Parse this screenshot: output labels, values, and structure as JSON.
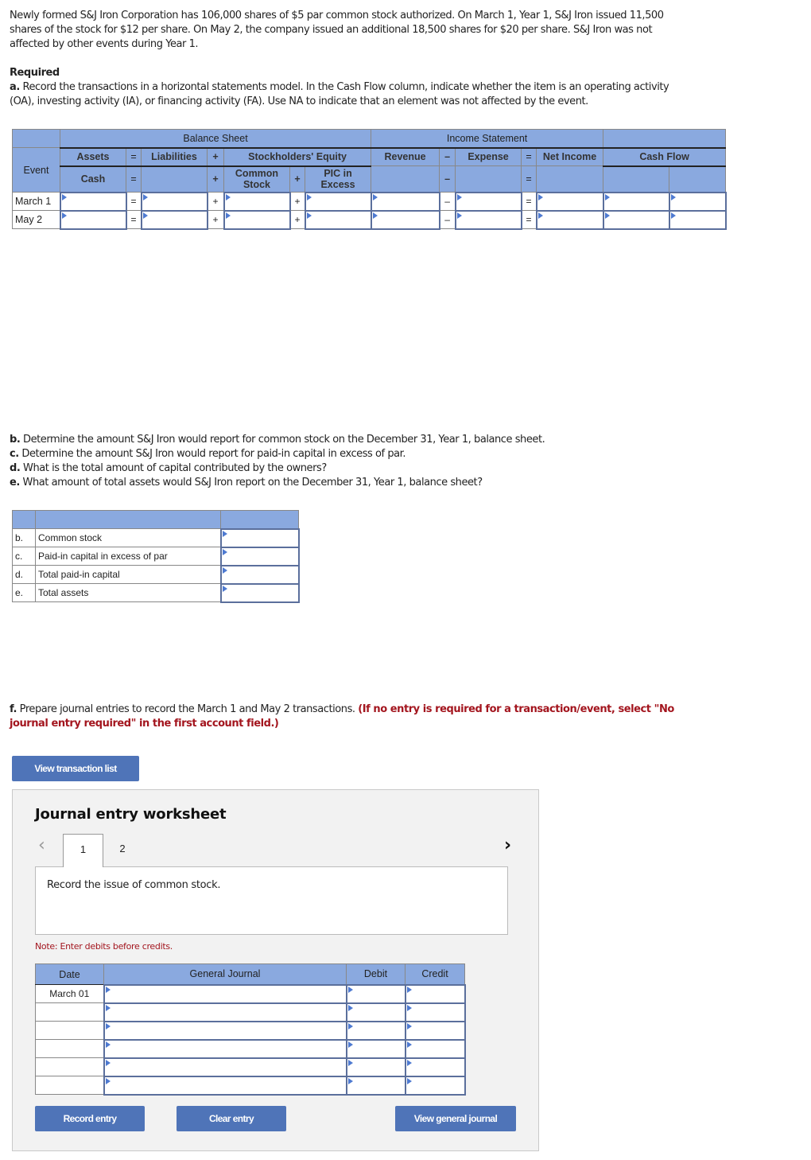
{
  "problem": {
    "intro": "Newly formed S&J Iron Corporation has 106,000 shares of $5 par common stock authorized. On March 1, Year 1, S&J Iron issued 11,500 shares of the stock for $12 per share. On May 2, the company issued an additional 18,500 shares for $20 per share. S&J Iron was not affected by other events during Year 1.",
    "intro_lines": [
      "Newly formed S&J Iron Corporation has 106,000 shares of $5 par common stock authorized. On March 1, Year 1, S&J Iron issued 11,500",
      "shares of the stock for $12 per share. On May 2, the company issued an additional 18,500 shares for $20 per share. S&J Iron was not",
      "affected by other events during Year 1."
    ],
    "required_label": "Required",
    "part_a_letter": "a.",
    "part_a_lines": [
      " Record the transactions in a horizontal statements model. In the Cash Flow column, indicate whether the item is an operating activity",
      "(OA), investing activity (IA), or financing activity (FA). Use NA to indicate that an element was not affected by the event."
    ]
  },
  "statements_model": {
    "group_headers": {
      "balance_sheet": "Balance Sheet",
      "income_statement": "Income Statement"
    },
    "row2": {
      "assets": "Assets",
      "eq": "=",
      "liabilities": "Liabilities",
      "plus": "+",
      "stockholders_equity": "Stockholders' Equity",
      "revenue": "Revenue",
      "minus": "–",
      "expense": "Expense",
      "eq2": "=",
      "net_income": "Net Income",
      "cash_flow": "Cash Flow"
    },
    "row3": {
      "event": "Event",
      "cash": "Cash",
      "eq": "=",
      "plus": "+",
      "common_stock_1": "Common",
      "common_stock_2": "Stock",
      "plus2": "+",
      "pic_1": "PIC in",
      "pic_2": "Excess",
      "minus": "–",
      "eq2": "="
    },
    "rows": [
      {
        "event": "March 1",
        "eq": "=",
        "plus1": "+",
        "plus2": "+",
        "minus": "–",
        "eq2": "=",
        "cash": "",
        "liabilities": "",
        "common_stock": "",
        "pic_in_excess": "",
        "revenue": "",
        "expense": "",
        "net_income": "",
        "cash_flow_amount": "",
        "cash_flow_activity": ""
      },
      {
        "event": "May 2",
        "eq": "=",
        "plus1": "+",
        "plus2": "+",
        "minus": "–",
        "eq2": "=",
        "cash": "",
        "liabilities": "",
        "common_stock": "",
        "pic_in_excess": "",
        "revenue": "",
        "expense": "",
        "net_income": "",
        "cash_flow_amount": "",
        "cash_flow_activity": ""
      }
    ]
  },
  "parts_bcde": {
    "lines": [
      {
        "letter": "b.",
        "text": " Determine the amount S&J Iron would report for common stock on the December 31, Year 1, balance sheet."
      },
      {
        "letter": "c.",
        "text": " Determine the amount S&J Iron would report for paid-in capital in excess of par."
      },
      {
        "letter": "d.",
        "text": " What is the total amount of capital contributed by the owners?"
      },
      {
        "letter": "e.",
        "text": " What amount of total assets would S&J Iron report on the December 31, Year 1, balance sheet?"
      }
    ],
    "table_rows": [
      {
        "letter": "b.",
        "label": "Common stock",
        "value": ""
      },
      {
        "letter": "c.",
        "label": "Paid-in capital in excess of par",
        "value": ""
      },
      {
        "letter": "d.",
        "label": "Total paid-in capital",
        "value": ""
      },
      {
        "letter": "e.",
        "label": "Total assets",
        "value": ""
      }
    ]
  },
  "part_f": {
    "letter": "f.",
    "text": " Prepare journal entries to record the March 1 and May 2 transactions. ",
    "instruction_line1": "(If no entry is required for a transaction/event, select \"No",
    "instruction_line2": "journal entry required\" in the first account field.)"
  },
  "buttons": {
    "view_transaction_list": "View transaction list",
    "record_entry": "Record entry",
    "clear_entry": "Clear entry",
    "view_general_journal": "View general journal"
  },
  "worksheet": {
    "title": "Journal entry worksheet",
    "prev_icon": "‹",
    "next_icon": "›",
    "tabs": [
      {
        "label": "1",
        "active": true
      },
      {
        "label": "2",
        "active": false
      }
    ],
    "description": "Record the issue of common stock.",
    "note": "Note: Enter debits before credits.",
    "columns": {
      "date": "Date",
      "general_journal": "General Journal",
      "debit": "Debit",
      "credit": "Credit"
    },
    "rows": [
      {
        "date": "March 01",
        "account": "",
        "debit": "",
        "credit": ""
      },
      {
        "date": "",
        "account": "",
        "debit": "",
        "credit": ""
      },
      {
        "date": "",
        "account": "",
        "debit": "",
        "credit": ""
      },
      {
        "date": "",
        "account": "",
        "debit": "",
        "credit": ""
      },
      {
        "date": "",
        "account": "",
        "debit": "",
        "credit": ""
      },
      {
        "date": "",
        "account": "",
        "debit": "",
        "credit": ""
      }
    ]
  },
  "colors": {
    "header_blue": "#8aa9df",
    "button_blue": "#4f74b8",
    "input_border": "#5b6f9c",
    "instruction_red": "#a3151e",
    "worksheet_bg": "#f2f2f2"
  }
}
